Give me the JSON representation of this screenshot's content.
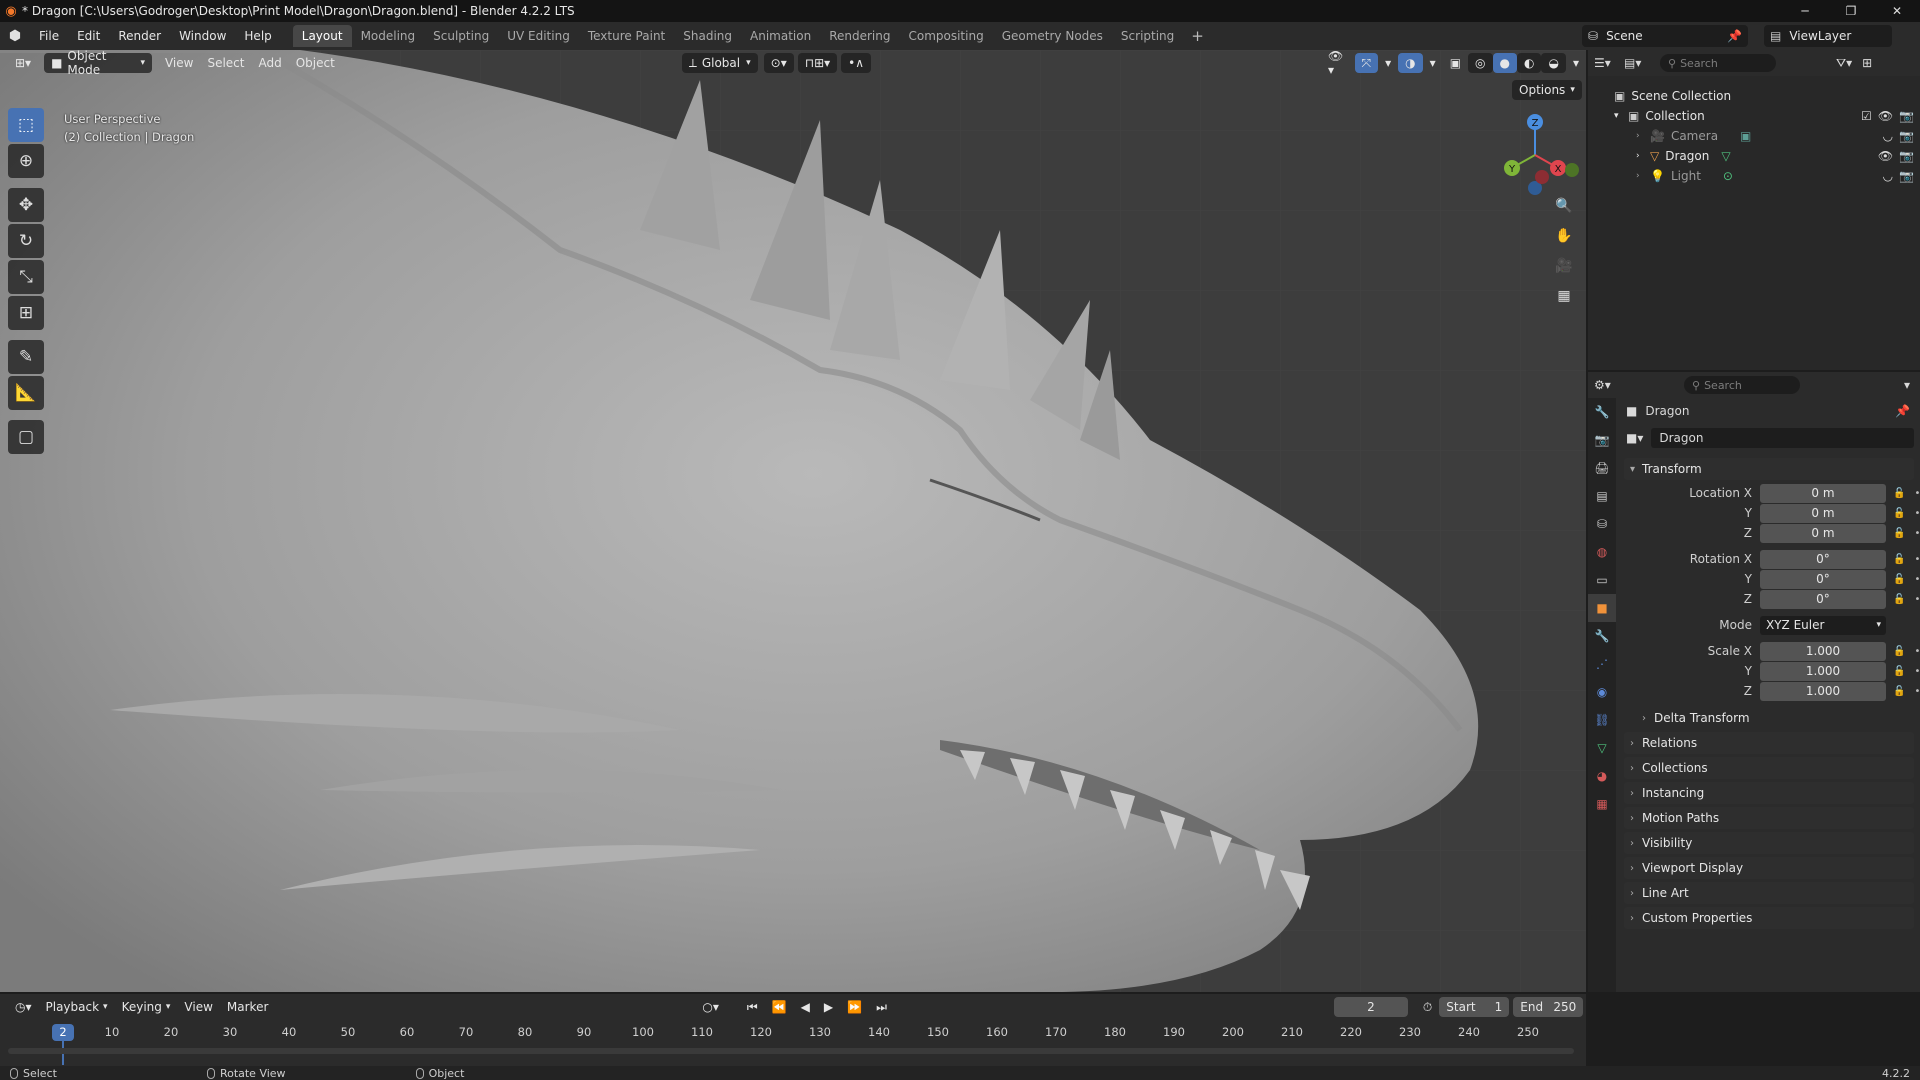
{
  "window": {
    "title": "* Dragon [C:\\Users\\Godroger\\Desktop\\Print Model\\Dragon\\Dragon.blend] - Blender 4.2.2 LTS",
    "minimize": "─",
    "restore": "❐",
    "close": "✕"
  },
  "menu": [
    "File",
    "Edit",
    "Render",
    "Window",
    "Help"
  ],
  "workspaces": [
    "Layout",
    "Modeling",
    "Sculpting",
    "UV Editing",
    "Texture Paint",
    "Shading",
    "Animation",
    "Rendering",
    "Compositing",
    "Geometry Nodes",
    "Scripting"
  ],
  "workspace_add": "+",
  "scene": {
    "name": "Scene",
    "view_layer": "ViewLayer"
  },
  "viewport": {
    "mode": "Object Mode",
    "menus": [
      "View",
      "Select",
      "Add",
      "Object"
    ],
    "orientation": "Global",
    "options": "Options",
    "info_line1": "User Perspective",
    "info_line2": "(2) Collection | Dragon",
    "gizmo": {
      "z": "Z",
      "y": "Y",
      "x": "X"
    }
  },
  "outliner": {
    "search_placeholder": "Search",
    "scene_collection": "Scene Collection",
    "collection": "Collection",
    "items": [
      {
        "name": "Camera",
        "dim": true
      },
      {
        "name": "Dragon",
        "dim": false
      },
      {
        "name": "Light",
        "dim": true
      }
    ]
  },
  "properties": {
    "search_placeholder": "Search",
    "object_name": "Dragon",
    "object_field": "Dragon",
    "transform_label": "Transform",
    "location": {
      "label_x": "Location X",
      "x": "0 m",
      "y": "0 m",
      "z": "0 m"
    },
    "rotation": {
      "label_x": "Rotation X",
      "x": "0°",
      "y": "0°",
      "z": "0°"
    },
    "mode_label": "Mode",
    "mode_value": "XYZ Euler",
    "scale": {
      "label_x": "Scale X",
      "x": "1.000",
      "y": "1.000",
      "z": "1.000"
    },
    "axis_y": "Y",
    "axis_z": "Z",
    "delta_transform": "Delta Transform",
    "panels": [
      "Relations",
      "Collections",
      "Instancing",
      "Motion Paths",
      "Visibility",
      "Viewport Display",
      "Line Art",
      "Custom Properties"
    ]
  },
  "timeline": {
    "menus": [
      "Playback",
      "Keying",
      "View",
      "Marker"
    ],
    "current_frame": "2",
    "start_label": "Start",
    "start_value": "1",
    "end_label": "End",
    "end_value": "250",
    "ruler_labels": [
      "10",
      "20",
      "30",
      "40",
      "50",
      "60",
      "70",
      "80",
      "90",
      "100",
      "110",
      "120",
      "130",
      "140",
      "150",
      "160",
      "170",
      "180",
      "190",
      "200",
      "210",
      "220",
      "230",
      "240",
      "250"
    ],
    "current_marker": "2"
  },
  "statusbar": {
    "select": "Select",
    "rotate": "Rotate View",
    "object": "Object",
    "version": "4.2.2"
  },
  "colors": {
    "accent": "#4772b3",
    "x_axis": "#e0454e",
    "y_axis": "#7fb538",
    "z_axis": "#4a8ee0",
    "blender_orange": "#f5792a"
  }
}
